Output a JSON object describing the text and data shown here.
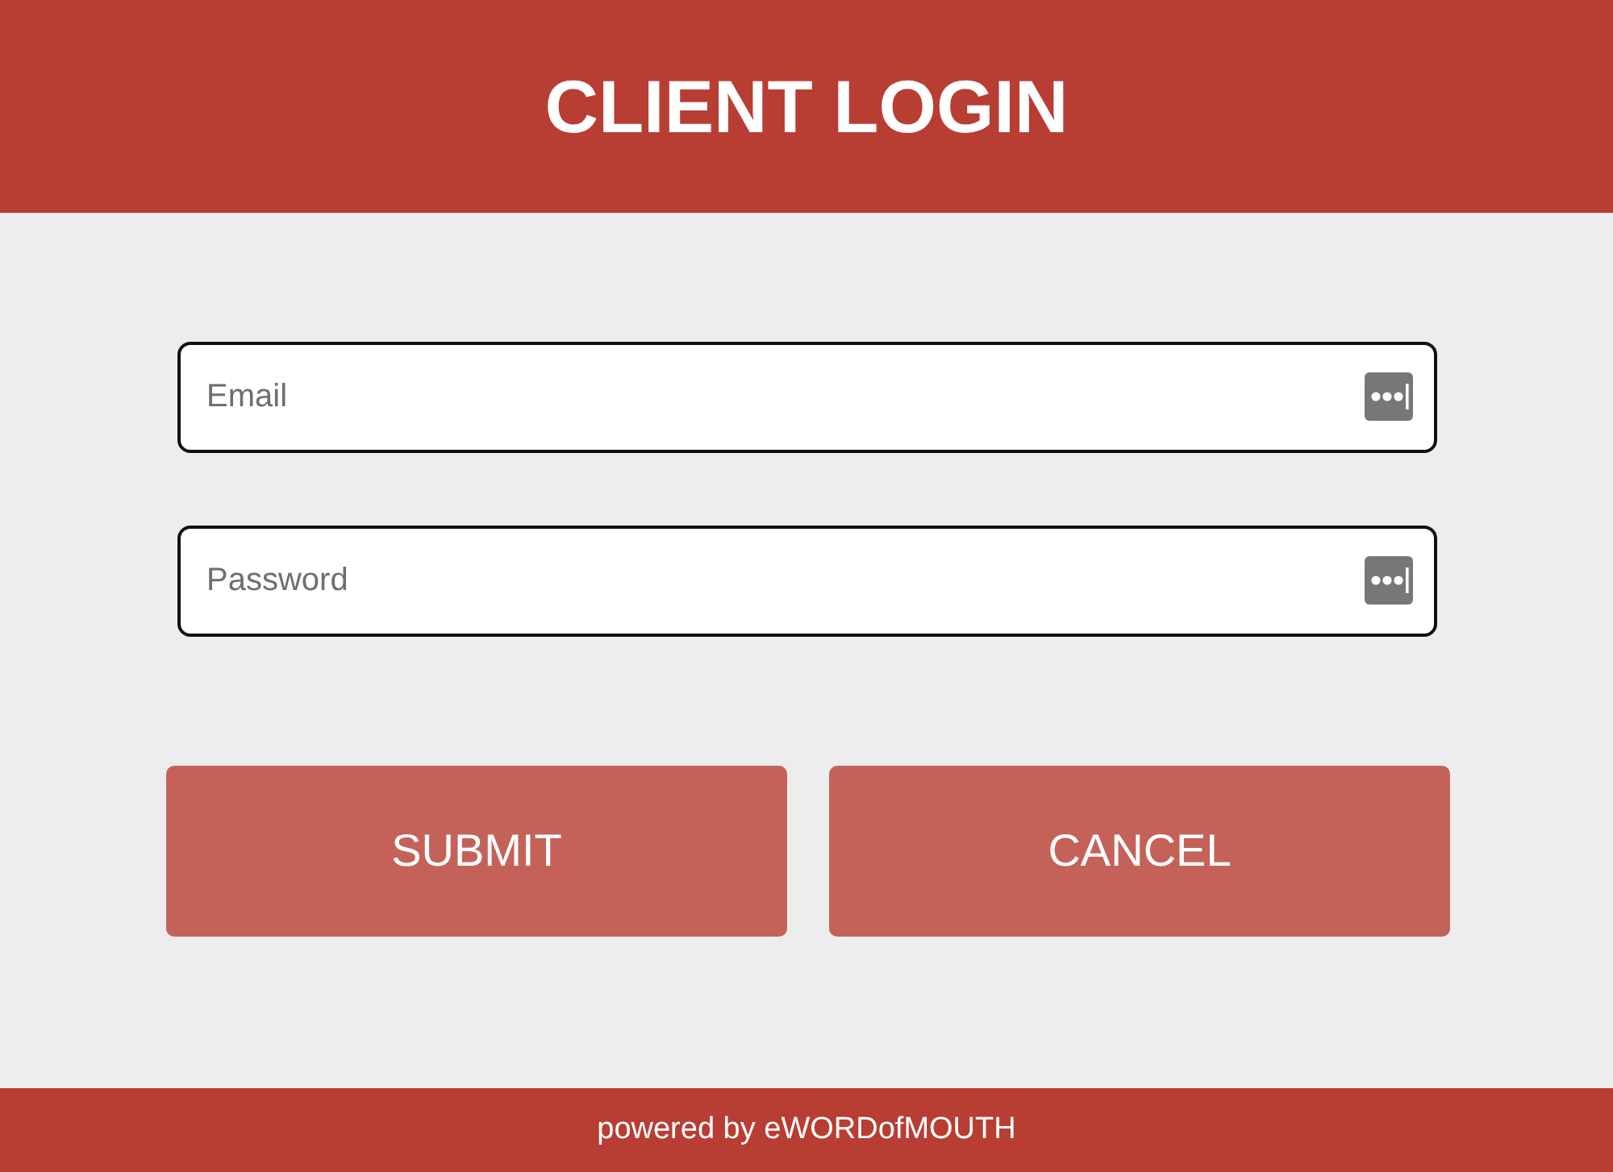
{
  "header": {
    "title": "CLIENT LOGIN"
  },
  "fields": [
    {
      "placeholder": "Email"
    },
    {
      "placeholder": "Password"
    }
  ],
  "buttons": [
    {
      "label": "SUBMIT"
    },
    {
      "label": "CANCEL"
    }
  ],
  "footer": {
    "text": "powered by eWORDofMOUTH"
  }
}
